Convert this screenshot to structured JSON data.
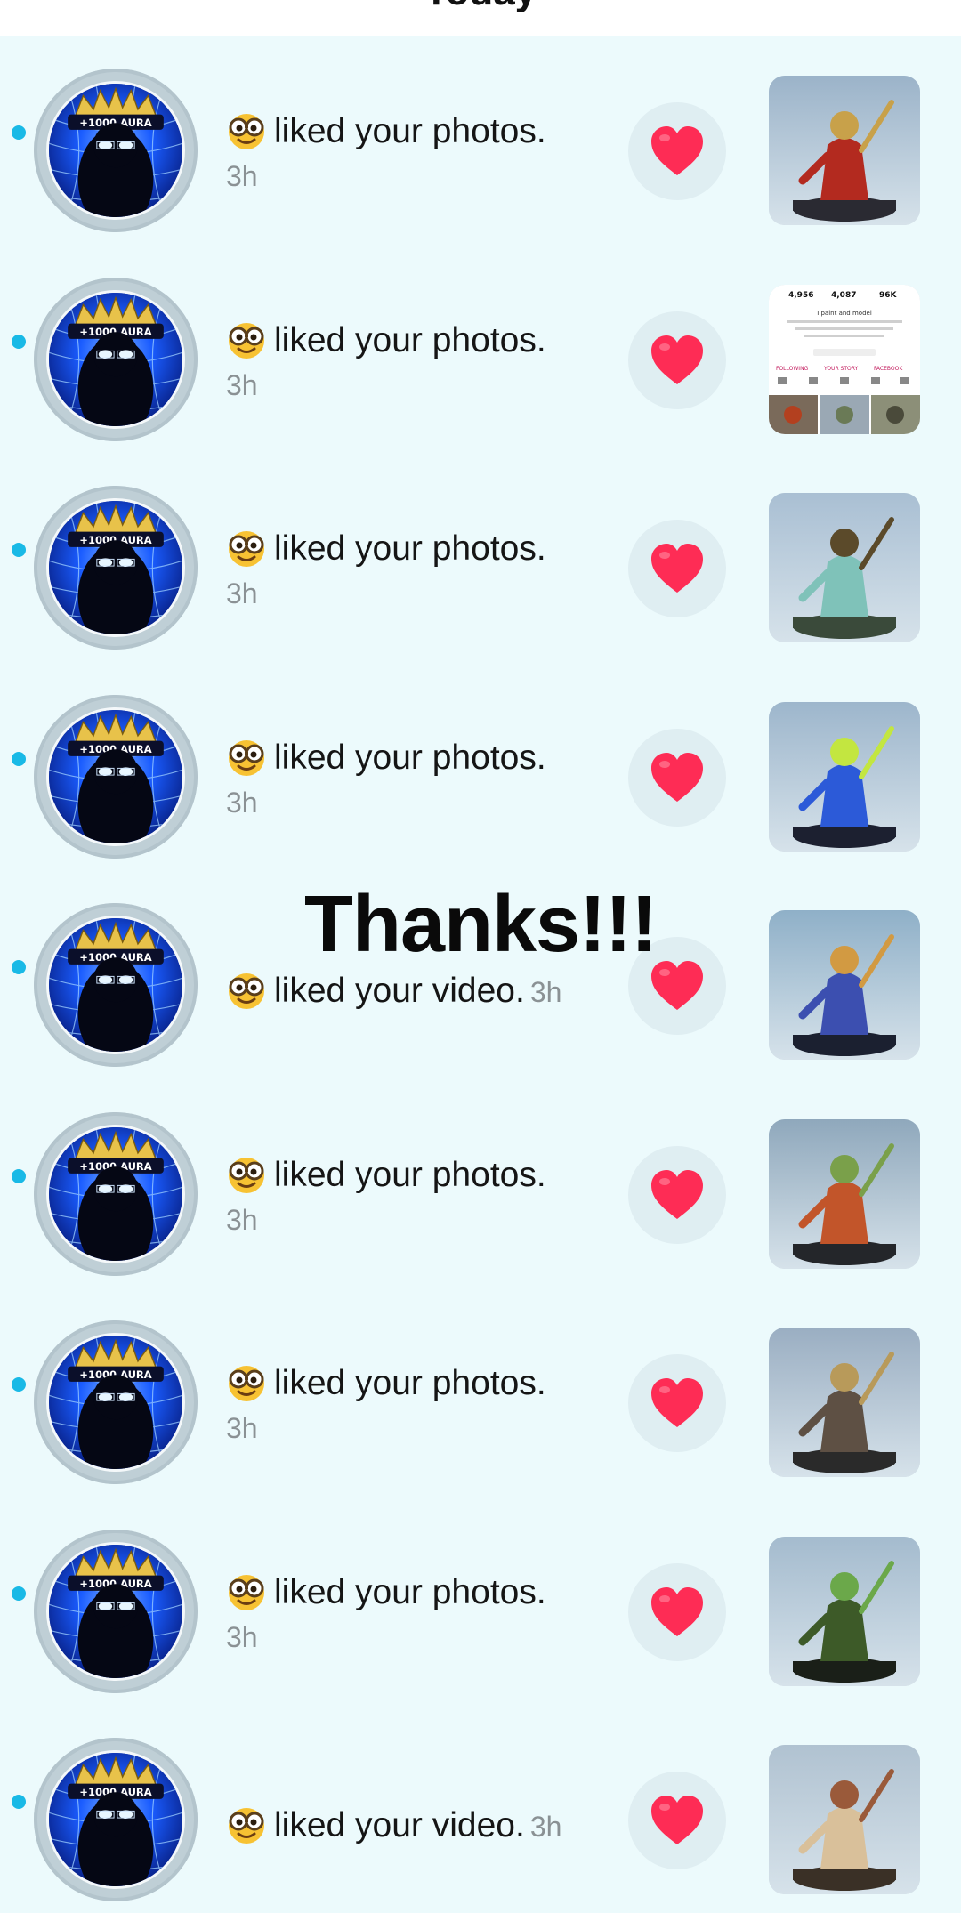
{
  "header": {
    "title": "Today"
  },
  "overlay_text": "Thanks!!!",
  "colors": {
    "background": "#ecfafc",
    "unread_dot": "#19b9e6",
    "heart": "#fe2c55",
    "avatar_glow": "#1a5cff"
  },
  "icons": {
    "like": "heart-icon",
    "user_emoji": "nerd-glasses-emoji"
  },
  "avatar_text": "+1000 AURA",
  "notifications": [
    {
      "message": "liked your photos.",
      "time": "3h",
      "thumbnail": "red-caped warrior miniature"
    },
    {
      "message": "liked your photos.",
      "time": "3h",
      "thumbnail": "profile screenshot",
      "profile_stats": [
        "4,956",
        "4,087",
        "96K"
      ],
      "profile_bio": "I paint and model",
      "profile_tabs": [
        "FOLLOWING",
        "YOUR STORY",
        "FACEBOOK"
      ]
    },
    {
      "message": "liked your photos.",
      "time": "3h",
      "thumbnail": "ghostly undead miniature"
    },
    {
      "message": "liked your photos.",
      "time": "3h",
      "thumbnail": "blue and red beast miniature"
    },
    {
      "message": "liked your video.",
      "time": "3h",
      "thumbnail": "archer miniature"
    },
    {
      "message": "liked your photos.",
      "time": "3h",
      "thumbnail": "squig monster miniature"
    },
    {
      "message": "liked your photos.",
      "time": "3h",
      "thumbnail": "armored mech miniature"
    },
    {
      "message": "liked your photos.",
      "time": "3h",
      "thumbnail": "green orc shaman miniature"
    },
    {
      "message": "liked your video.",
      "time": "3h",
      "thumbnail": "pale warrior miniature"
    }
  ]
}
